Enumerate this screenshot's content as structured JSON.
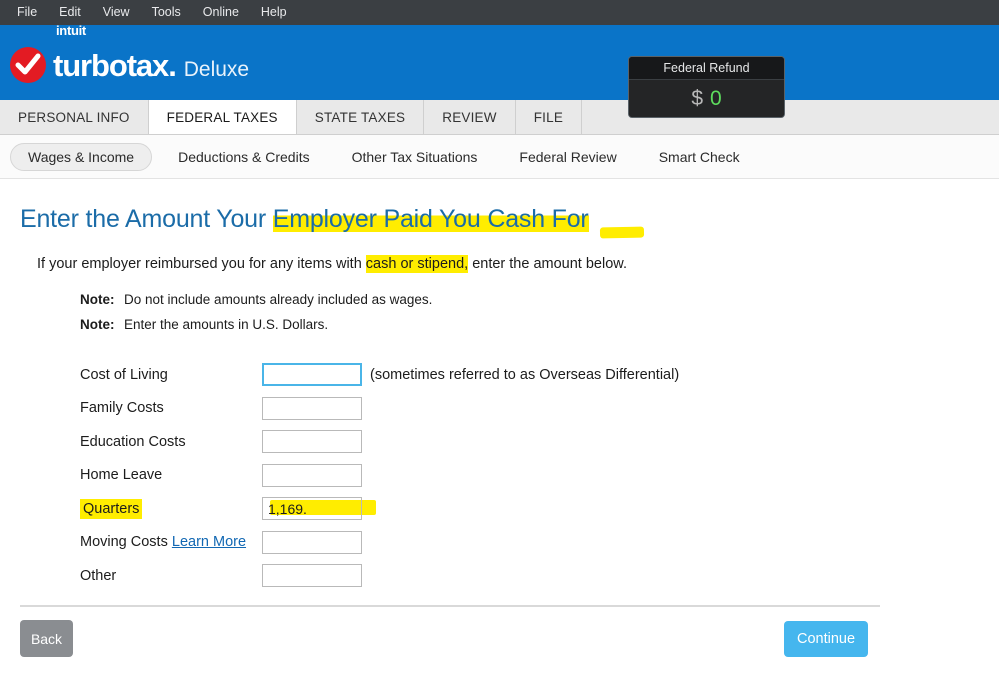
{
  "menubar": {
    "items": [
      "File",
      "Edit",
      "View",
      "Tools",
      "Online",
      "Help"
    ]
  },
  "brand": {
    "intuit": "intuit",
    "product": "turbotax",
    "product_dot": ".",
    "edition": "Deluxe",
    "logo_icon": "check-circle-icon",
    "header_color": "#0a74c8"
  },
  "refund": {
    "title": "Federal Refund",
    "currency": "$",
    "value": "0",
    "value_color": "#5ddc5d"
  },
  "main_tabs": [
    {
      "label": "PERSONAL INFO",
      "active": false
    },
    {
      "label": "FEDERAL TAXES",
      "active": true
    },
    {
      "label": "STATE TAXES",
      "active": false
    },
    {
      "label": "REVIEW",
      "active": false
    },
    {
      "label": "FILE",
      "active": false
    }
  ],
  "sub_tabs": [
    {
      "label": "Wages & Income",
      "active": true
    },
    {
      "label": "Deductions & Credits",
      "active": false
    },
    {
      "label": "Other Tax Situations",
      "active": false
    },
    {
      "label": "Federal Review",
      "active": false
    },
    {
      "label": "Smart Check",
      "active": false
    }
  ],
  "page": {
    "title_plain": "Enter the Amount Your ",
    "title_highlighted": "Employer Paid You Cash For",
    "title_color": "#1b6ca8",
    "highlight_color": "#ffed00",
    "description_pre": "If your employer reimbursed you for any items with ",
    "description_highlighted": "cash or stipend,",
    "description_post": " enter the amount below.",
    "notes": [
      {
        "label": "Note:",
        "text": "Do not include amounts already included as wages."
      },
      {
        "label": "Note:",
        "text": "Enter the amounts in U.S. Dollars."
      }
    ]
  },
  "form": {
    "fields": [
      {
        "label": "Cost of Living",
        "value": "",
        "hint": "(sometimes referred to as Overseas Differential)",
        "focused": true,
        "highlighted": false
      },
      {
        "label": "Family Costs",
        "value": "",
        "hint": "",
        "focused": false,
        "highlighted": false
      },
      {
        "label": "Education Costs",
        "value": "",
        "hint": "",
        "focused": false,
        "highlighted": false
      },
      {
        "label": "Home Leave",
        "value": "",
        "hint": "",
        "focused": false,
        "highlighted": false
      },
      {
        "label": "Quarters",
        "value": "1,169.",
        "hint": "",
        "focused": false,
        "highlighted": true
      },
      {
        "label": "Moving Costs",
        "link": "Learn More",
        "value": "",
        "hint": "",
        "focused": false,
        "highlighted": false
      },
      {
        "label": "Other",
        "value": "",
        "hint": "",
        "focused": false,
        "highlighted": false
      }
    ]
  },
  "footer": {
    "back_label": "Back",
    "continue_label": "Continue",
    "back_color": "#8a8d91",
    "continue_color": "#45b6ee"
  }
}
